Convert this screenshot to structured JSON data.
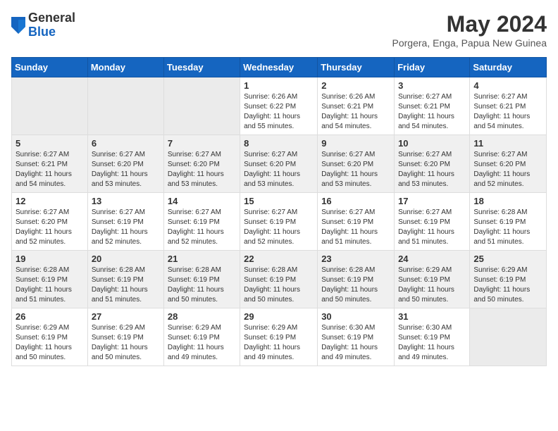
{
  "header": {
    "logo_general": "General",
    "logo_blue": "Blue",
    "month_year": "May 2024",
    "location": "Porgera, Enga, Papua New Guinea"
  },
  "days_of_week": [
    "Sunday",
    "Monday",
    "Tuesday",
    "Wednesday",
    "Thursday",
    "Friday",
    "Saturday"
  ],
  "weeks": [
    [
      {
        "day": "",
        "info": ""
      },
      {
        "day": "",
        "info": ""
      },
      {
        "day": "",
        "info": ""
      },
      {
        "day": "1",
        "info": "Sunrise: 6:26 AM\nSunset: 6:22 PM\nDaylight: 11 hours\nand 55 minutes."
      },
      {
        "day": "2",
        "info": "Sunrise: 6:26 AM\nSunset: 6:21 PM\nDaylight: 11 hours\nand 54 minutes."
      },
      {
        "day": "3",
        "info": "Sunrise: 6:27 AM\nSunset: 6:21 PM\nDaylight: 11 hours\nand 54 minutes."
      },
      {
        "day": "4",
        "info": "Sunrise: 6:27 AM\nSunset: 6:21 PM\nDaylight: 11 hours\nand 54 minutes."
      }
    ],
    [
      {
        "day": "5",
        "info": "Sunrise: 6:27 AM\nSunset: 6:21 PM\nDaylight: 11 hours\nand 54 minutes."
      },
      {
        "day": "6",
        "info": "Sunrise: 6:27 AM\nSunset: 6:20 PM\nDaylight: 11 hours\nand 53 minutes."
      },
      {
        "day": "7",
        "info": "Sunrise: 6:27 AM\nSunset: 6:20 PM\nDaylight: 11 hours\nand 53 minutes."
      },
      {
        "day": "8",
        "info": "Sunrise: 6:27 AM\nSunset: 6:20 PM\nDaylight: 11 hours\nand 53 minutes."
      },
      {
        "day": "9",
        "info": "Sunrise: 6:27 AM\nSunset: 6:20 PM\nDaylight: 11 hours\nand 53 minutes."
      },
      {
        "day": "10",
        "info": "Sunrise: 6:27 AM\nSunset: 6:20 PM\nDaylight: 11 hours\nand 53 minutes."
      },
      {
        "day": "11",
        "info": "Sunrise: 6:27 AM\nSunset: 6:20 PM\nDaylight: 11 hours\nand 52 minutes."
      }
    ],
    [
      {
        "day": "12",
        "info": "Sunrise: 6:27 AM\nSunset: 6:20 PM\nDaylight: 11 hours\nand 52 minutes."
      },
      {
        "day": "13",
        "info": "Sunrise: 6:27 AM\nSunset: 6:19 PM\nDaylight: 11 hours\nand 52 minutes."
      },
      {
        "day": "14",
        "info": "Sunrise: 6:27 AM\nSunset: 6:19 PM\nDaylight: 11 hours\nand 52 minutes."
      },
      {
        "day": "15",
        "info": "Sunrise: 6:27 AM\nSunset: 6:19 PM\nDaylight: 11 hours\nand 52 minutes."
      },
      {
        "day": "16",
        "info": "Sunrise: 6:27 AM\nSunset: 6:19 PM\nDaylight: 11 hours\nand 51 minutes."
      },
      {
        "day": "17",
        "info": "Sunrise: 6:27 AM\nSunset: 6:19 PM\nDaylight: 11 hours\nand 51 minutes."
      },
      {
        "day": "18",
        "info": "Sunrise: 6:28 AM\nSunset: 6:19 PM\nDaylight: 11 hours\nand 51 minutes."
      }
    ],
    [
      {
        "day": "19",
        "info": "Sunrise: 6:28 AM\nSunset: 6:19 PM\nDaylight: 11 hours\nand 51 minutes."
      },
      {
        "day": "20",
        "info": "Sunrise: 6:28 AM\nSunset: 6:19 PM\nDaylight: 11 hours\nand 51 minutes."
      },
      {
        "day": "21",
        "info": "Sunrise: 6:28 AM\nSunset: 6:19 PM\nDaylight: 11 hours\nand 50 minutes."
      },
      {
        "day": "22",
        "info": "Sunrise: 6:28 AM\nSunset: 6:19 PM\nDaylight: 11 hours\nand 50 minutes."
      },
      {
        "day": "23",
        "info": "Sunrise: 6:28 AM\nSunset: 6:19 PM\nDaylight: 11 hours\nand 50 minutes."
      },
      {
        "day": "24",
        "info": "Sunrise: 6:29 AM\nSunset: 6:19 PM\nDaylight: 11 hours\nand 50 minutes."
      },
      {
        "day": "25",
        "info": "Sunrise: 6:29 AM\nSunset: 6:19 PM\nDaylight: 11 hours\nand 50 minutes."
      }
    ],
    [
      {
        "day": "26",
        "info": "Sunrise: 6:29 AM\nSunset: 6:19 PM\nDaylight: 11 hours\nand 50 minutes."
      },
      {
        "day": "27",
        "info": "Sunrise: 6:29 AM\nSunset: 6:19 PM\nDaylight: 11 hours\nand 50 minutes."
      },
      {
        "day": "28",
        "info": "Sunrise: 6:29 AM\nSunset: 6:19 PM\nDaylight: 11 hours\nand 49 minutes."
      },
      {
        "day": "29",
        "info": "Sunrise: 6:29 AM\nSunset: 6:19 PM\nDaylight: 11 hours\nand 49 minutes."
      },
      {
        "day": "30",
        "info": "Sunrise: 6:30 AM\nSunset: 6:19 PM\nDaylight: 11 hours\nand 49 minutes."
      },
      {
        "day": "31",
        "info": "Sunrise: 6:30 AM\nSunset: 6:19 PM\nDaylight: 11 hours\nand 49 minutes."
      },
      {
        "day": "",
        "info": ""
      }
    ]
  ]
}
